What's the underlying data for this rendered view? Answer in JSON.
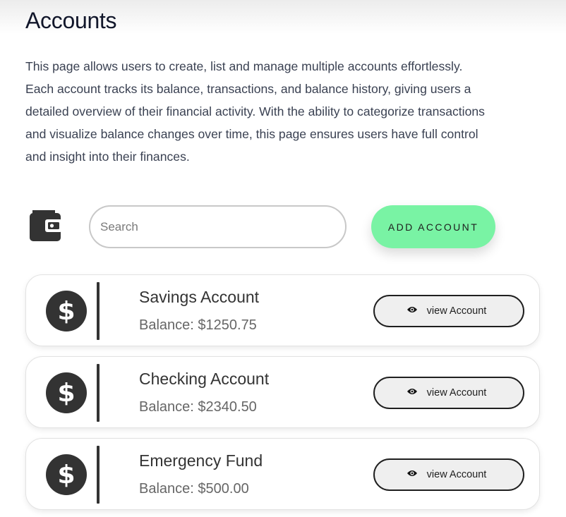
{
  "header": {
    "title": "Accounts",
    "description": "This page allows users to create, list and manage multiple accounts effortlessly. Each account tracks its balance, transactions, and balance history, giving users a detailed overview of their financial activity. With the ability to categorize transactions and visualize balance changes over time, this page ensures users have full control and insight into their finances."
  },
  "toolbar": {
    "icon": "wallet-icon",
    "search_placeholder": "Search",
    "search_value": "",
    "add_label": "ADD ACCOUNT"
  },
  "accounts": [
    {
      "icon": "dollar-icon",
      "name": "Savings Account",
      "balance_label": "Balance: ",
      "balance": "$1250.75",
      "view_label": "view Account"
    },
    {
      "icon": "dollar-icon",
      "name": "Checking Account",
      "balance_label": "Balance: ",
      "balance": "$2340.50",
      "view_label": "view Account"
    },
    {
      "icon": "dollar-icon",
      "name": "Emergency Fund",
      "balance_label": "Balance: ",
      "balance": "$500.00",
      "view_label": "view Account"
    }
  ],
  "colors": {
    "title": "#12172b",
    "accent": "#79f3a4",
    "dark": "#333333",
    "button_bg": "#efefef"
  }
}
